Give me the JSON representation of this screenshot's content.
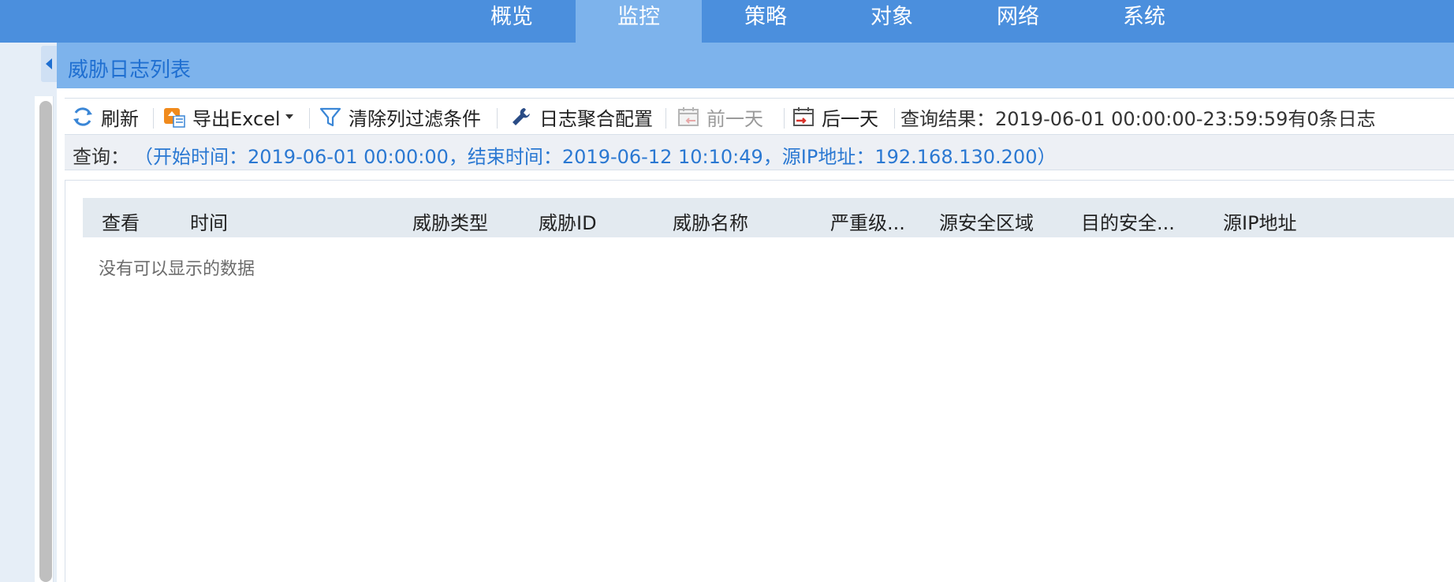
{
  "nav": {
    "tabs": [
      {
        "label": "概览",
        "active": false
      },
      {
        "label": "监控",
        "active": true
      },
      {
        "label": "策略",
        "active": false
      },
      {
        "label": "对象",
        "active": false
      },
      {
        "label": "网络",
        "active": false
      },
      {
        "label": "系统",
        "active": false
      }
    ]
  },
  "panel": {
    "title": "威胁日志列表"
  },
  "toolbar": {
    "refresh": "刷新",
    "export": "导出Excel",
    "clear_filter": "清除列过滤条件",
    "log_agg": "日志聚合配置",
    "prev_day": "前一天",
    "next_day": "后一天",
    "result": "查询结果：2019-06-01 00:00:00-23:59:59有0条日志"
  },
  "query": {
    "label": "查询：",
    "value": "（开始时间：2019-06-01 00:00:00，结束时间：2019-06-12 10:10:49，源IP地址：192.168.130.200）"
  },
  "grid": {
    "columns": [
      "查看",
      "时间",
      "威胁类型",
      "威胁ID",
      "威胁名称",
      "严重级...",
      "源安全区域",
      "目的安全...",
      "源IP地址"
    ],
    "empty_text": "没有可以显示的数据"
  },
  "colors": {
    "nav_bg": "#4b8fdd",
    "nav_active": "#7db3ec",
    "accent_text": "#1f6fd1",
    "query_value": "#2a78d2"
  }
}
